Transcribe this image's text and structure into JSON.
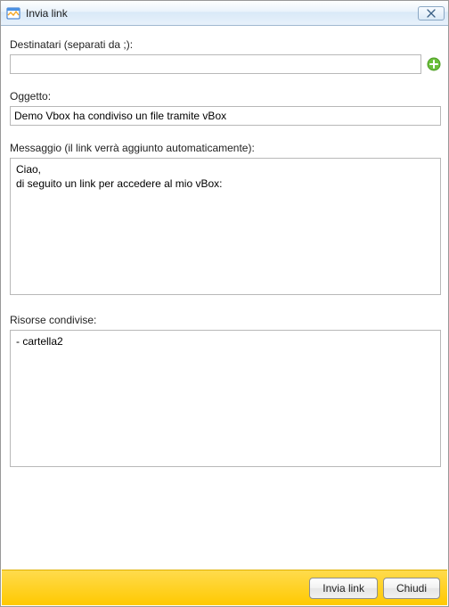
{
  "window": {
    "title": "Invia link"
  },
  "labels": {
    "recipients": "Destinatari (separati da ;):",
    "subject": "Oggetto:",
    "message": "Messaggio (il link verrà aggiunto automaticamente):",
    "resources": "Risorse condivise:"
  },
  "fields": {
    "recipients_value": "",
    "subject_value": "Demo Vbox ha condiviso un file tramite vBox",
    "message_value": "Ciao,\ndi seguito un link per accedere al mio vBox:",
    "resources_value": "- cartella2"
  },
  "buttons": {
    "send": "Invia link",
    "close": "Chiudi"
  },
  "icons": {
    "app": "app-icon",
    "close_x": "✕",
    "add": "add-icon"
  }
}
